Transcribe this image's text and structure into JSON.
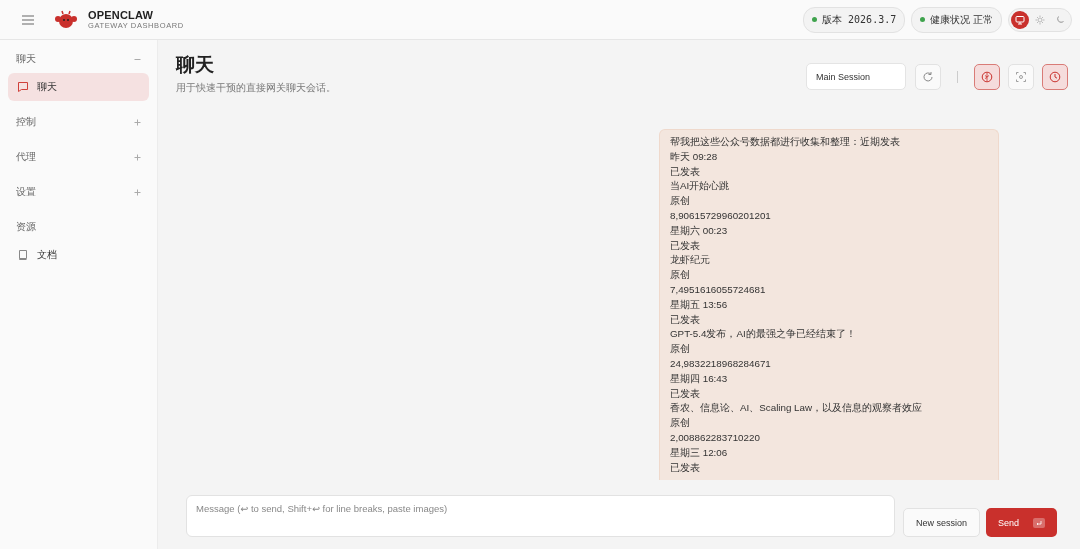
{
  "brand": {
    "title": "OPENCLAW",
    "subtitle": "GATEWAY DASHBOARD"
  },
  "status_pills": [
    {
      "label": "版本 2026.3.7",
      "color": "#3fa34d"
    },
    {
      "label": "健康状况 正常",
      "color": "#3fa34d"
    }
  ],
  "theme_toggle": [
    {
      "kind": "system",
      "selected": true
    },
    {
      "kind": "light",
      "selected": false
    },
    {
      "kind": "dark",
      "selected": false
    }
  ],
  "sidebar": {
    "groups": [
      {
        "label": "聊天",
        "expanded": true,
        "items": [
          {
            "label": "聊天",
            "selected": true
          }
        ]
      },
      {
        "label": "控制",
        "expanded": false
      },
      {
        "label": "代理",
        "expanded": false
      },
      {
        "label": "设置",
        "expanded": false
      },
      {
        "label": "资源",
        "items": [
          {
            "label": "文档",
            "selected": false
          }
        ]
      }
    ]
  },
  "page": {
    "title": "聊天",
    "subtitle": "用于快速干预的直接网关聊天会话。"
  },
  "toolbar": {
    "session": "Main Session",
    "tools": [
      {
        "kind": "refresh",
        "active": false
      },
      {
        "kind": "separator"
      },
      {
        "kind": "thinking",
        "active": true
      },
      {
        "kind": "focus",
        "active": false
      },
      {
        "kind": "cron",
        "active": true
      }
    ]
  },
  "message": {
    "lines": [
      "帮我把这些公众号数据都进行收集和整理：近期发表",
      "昨天 09:28",
      "已发表",
      "当AI开始心跳",
      "原创",
      "8,90615729960201201",
      "星期六 00:23",
      "已发表",
      "龙虾纪元",
      "原创",
      "7,4951616055724681",
      "星期五 13:56",
      "已发表",
      "GPT-5.4发布，AI的最强之争已经结束了！",
      "原创",
      "24,9832218968284671",
      "星期四 16:43",
      "已发表",
      "香农、信息论、AI、Scaling Law，以及信息的观察者效应",
      "原创",
      "2,008862283710220",
      "星期三 12:06",
      "已发表"
    ]
  },
  "composer": {
    "placeholder": "Message (↩ to send, Shift+↩ for line breaks, paste images)",
    "new_session": "New session",
    "send": "Send"
  }
}
